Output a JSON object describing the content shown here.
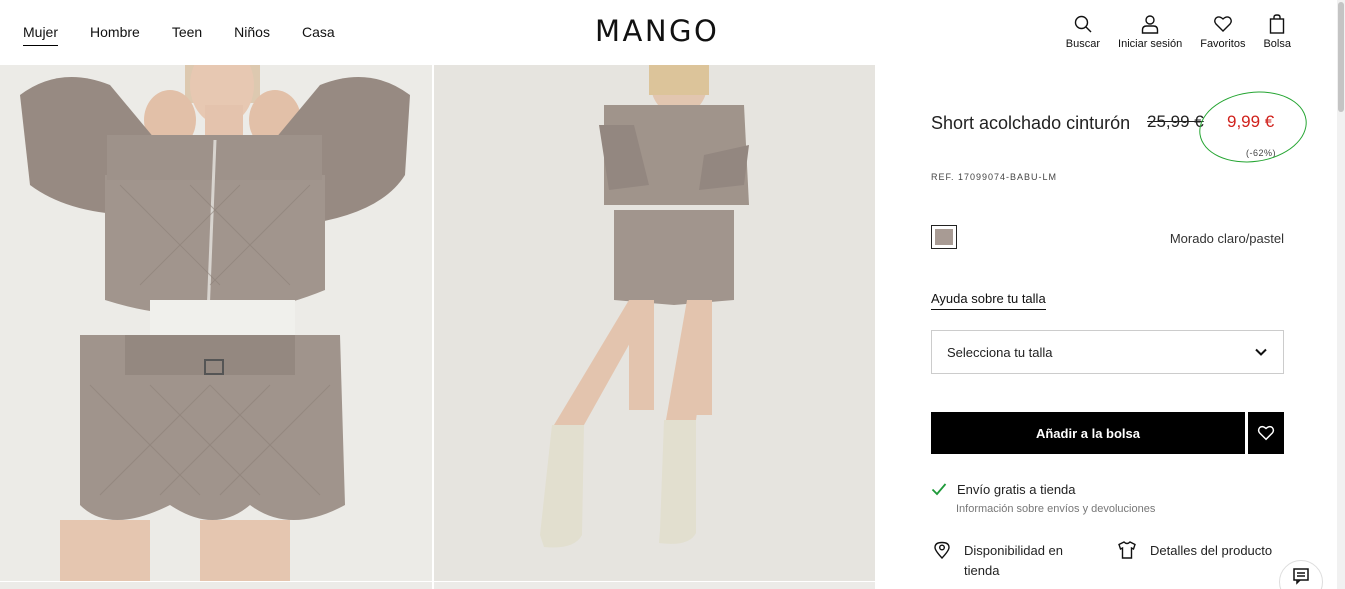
{
  "nav": {
    "items": [
      {
        "label": "Mujer",
        "active": true
      },
      {
        "label": "Hombre",
        "active": false
      },
      {
        "label": "Teen",
        "active": false
      },
      {
        "label": "Niños",
        "active": false
      },
      {
        "label": "Casa",
        "active": false
      }
    ]
  },
  "brand": {
    "logo": "MANGO"
  },
  "tools": {
    "search": "Buscar",
    "login": "Iniciar sesión",
    "favorites": "Favoritos",
    "bag": "Bolsa"
  },
  "product": {
    "name": "Short acolchado cinturón",
    "ref": "REF. 17099074-BABU-LM",
    "old_price": "25,99 €",
    "new_price": "9,99 €",
    "discount": "(-62%)",
    "color_name": "Morado claro/pastel",
    "swatch_color": "#a89b94",
    "size_help": "Ayuda sobre tu talla",
    "size_select": "Selecciona tu talla",
    "add_to_bag": "Añadir a la bolsa",
    "shipping": "Envío gratis a tienda",
    "shipping_info": "Información sobre envíos y devoluciones",
    "availability": "Disponibilidad en tienda",
    "details": "Detalles del producto"
  },
  "colors": {
    "sale": "#d0211c",
    "annotation": "#25a532",
    "check": "#1f9a3a"
  }
}
